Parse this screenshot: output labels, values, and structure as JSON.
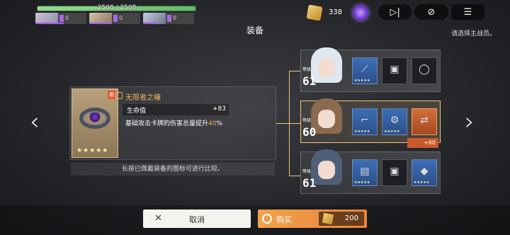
{
  "header": {
    "hp_text": "2508 / 2508",
    "hp_fraction": 1.0,
    "party": [
      {
        "mp": "0"
      },
      {
        "mp": "0"
      },
      {
        "mp": "0"
      }
    ],
    "gold": "338",
    "title": "装备",
    "hint": "请选择主战员。",
    "icons": {
      "play": "skip-forward-icon",
      "speed": "speed-icon",
      "menu": "menu-icon"
    }
  },
  "item": {
    "new_badge": "新",
    "name": "无限者之瞳",
    "stat_label": "生命值",
    "stat_value": "+83",
    "desc_prefix": "基础攻击卡牌的伤害总量提升",
    "desc_highlight": "40",
    "desc_suffix": "%",
    "stars": "★★★★★",
    "compare_hint": "长按已佩戴装备的图标可进行比较。"
  },
  "characters": [
    {
      "level_label": "等级",
      "level": "61",
      "hair": "#dfe8f0",
      "slots": [
        "weapon",
        "empty",
        "empty"
      ]
    },
    {
      "level_label": "等级",
      "level": "60",
      "hair": "#8b6a4e",
      "slots": [
        "weapon",
        "gear",
        "new"
      ],
      "bonus": "+60"
    },
    {
      "level_label": "等级",
      "level": "61",
      "hair": "#4f5f78",
      "slots": [
        "book",
        "empty",
        "gem"
      ]
    }
  ],
  "buttons": {
    "cancel": "取消",
    "buy": "购买",
    "price": "200"
  },
  "colors": {
    "accent": "#f0b05a",
    "buy": "#e8843a",
    "selected_border": "#f0c680"
  }
}
